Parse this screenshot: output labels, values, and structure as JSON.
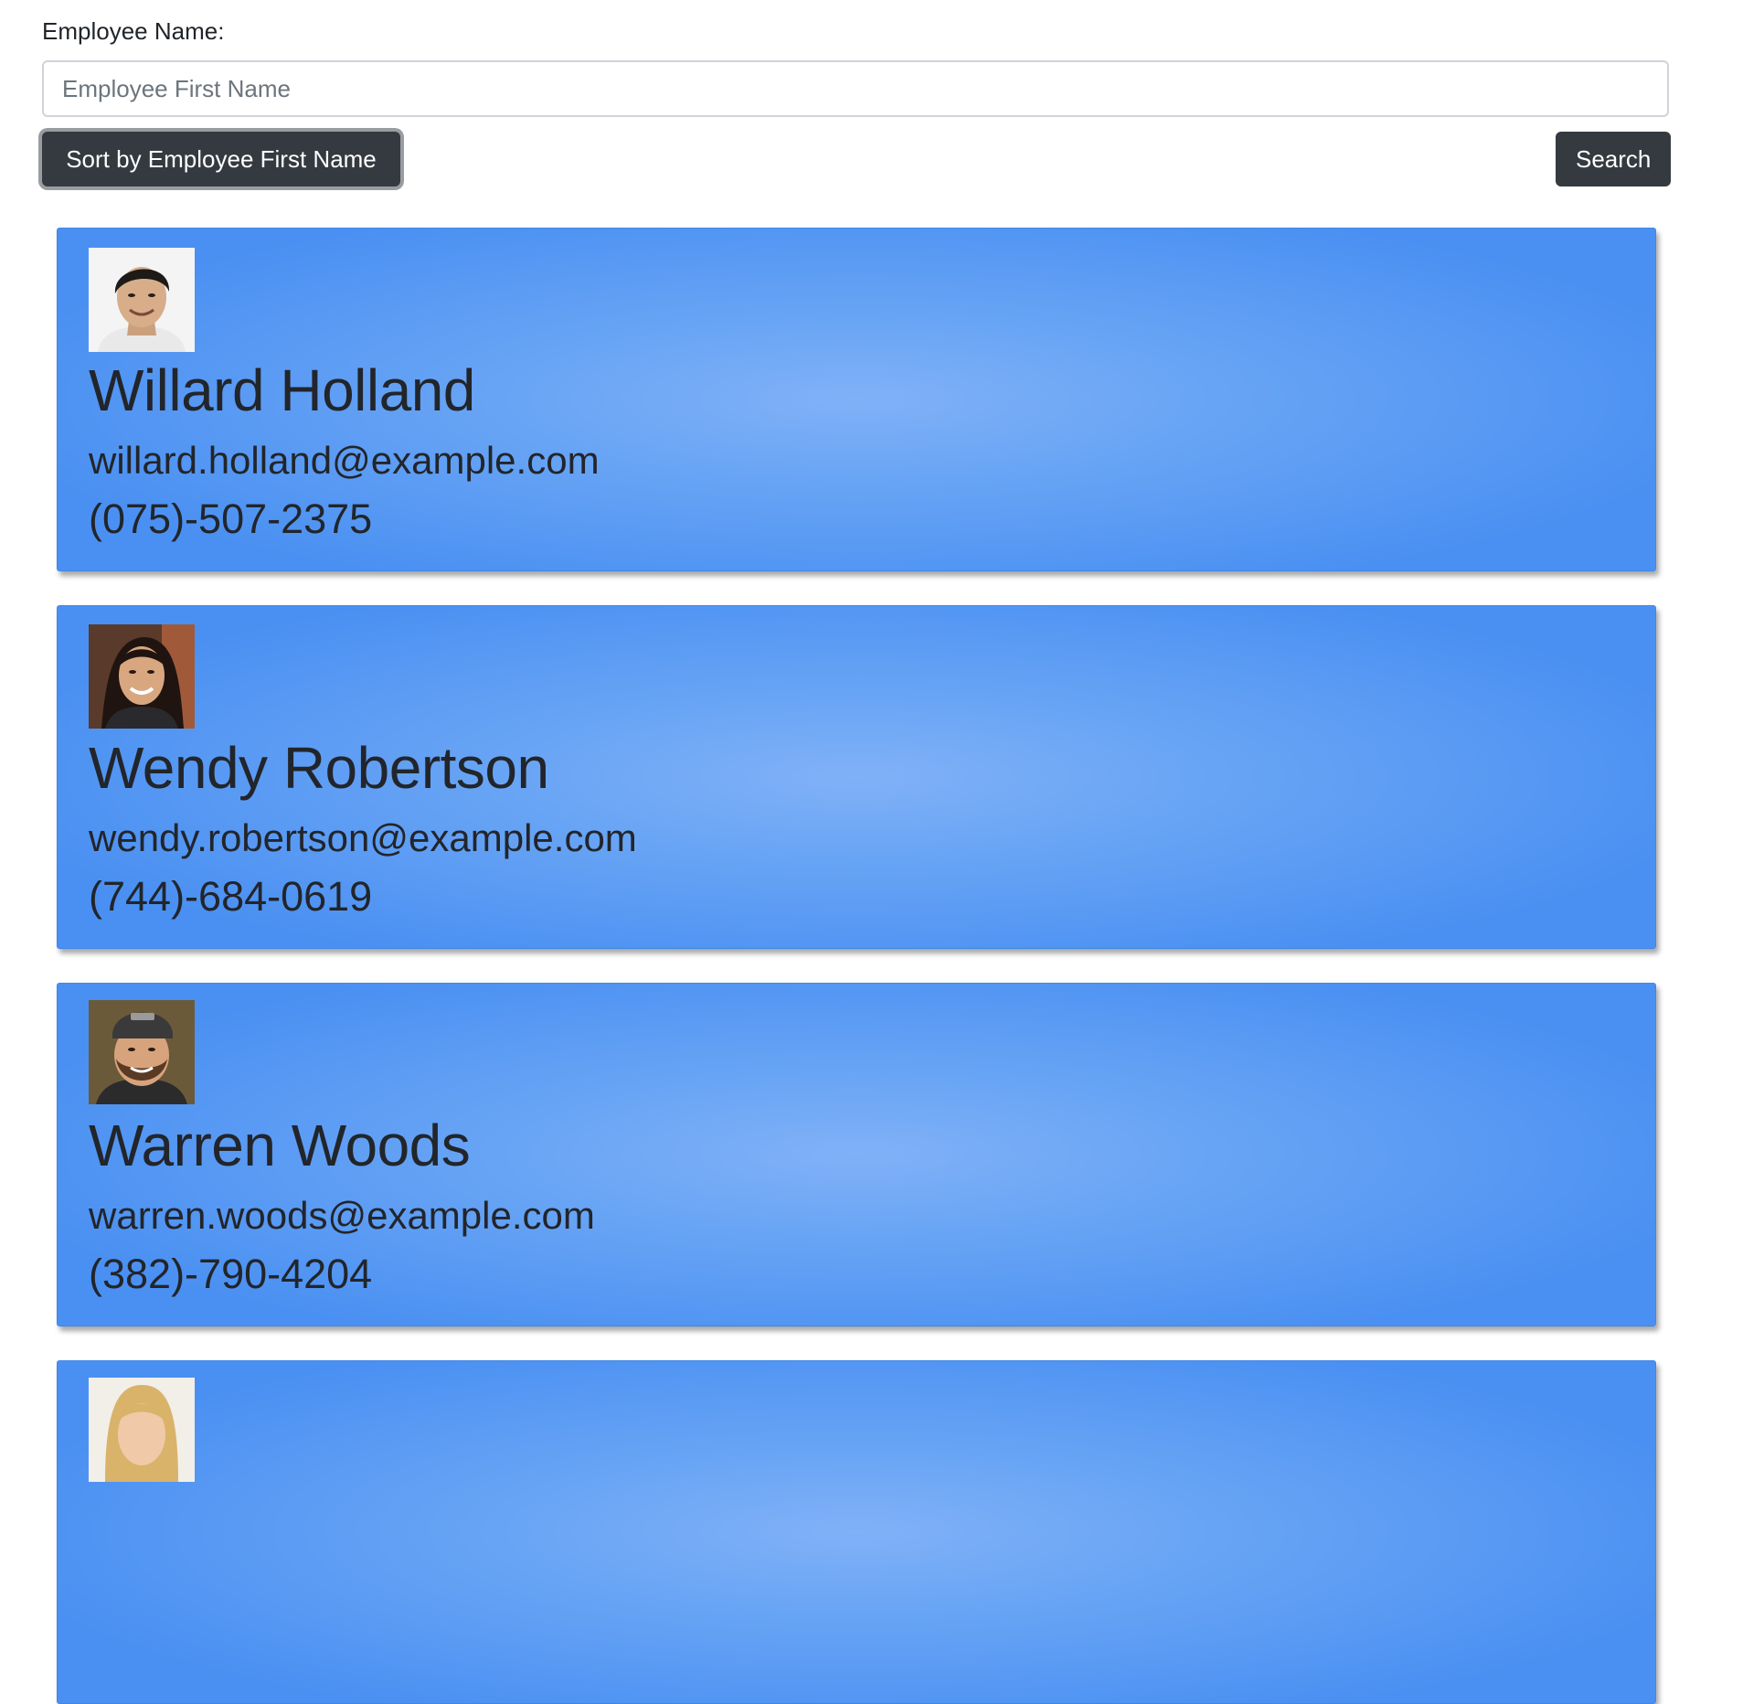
{
  "search": {
    "label": "Employee Name:",
    "placeholder": "Employee First Name",
    "value": "",
    "sort_button_label": "Sort by Employee First Name",
    "search_button_label": "Search"
  },
  "employees": [
    {
      "name": "Willard Holland",
      "email": "willard.holland@example.com",
      "phone": "(075)-507-2375"
    },
    {
      "name": "Wendy Robertson",
      "email": "wendy.robertson@example.com",
      "phone": "(744)-684-0619"
    },
    {
      "name": "Warren Woods",
      "email": "warren.woods@example.com",
      "phone": "(382)-790-4204"
    },
    {
      "name": "",
      "email": "",
      "phone": ""
    }
  ],
  "colors": {
    "card_blue": "#4a90f2",
    "button_dark": "#343a40"
  }
}
